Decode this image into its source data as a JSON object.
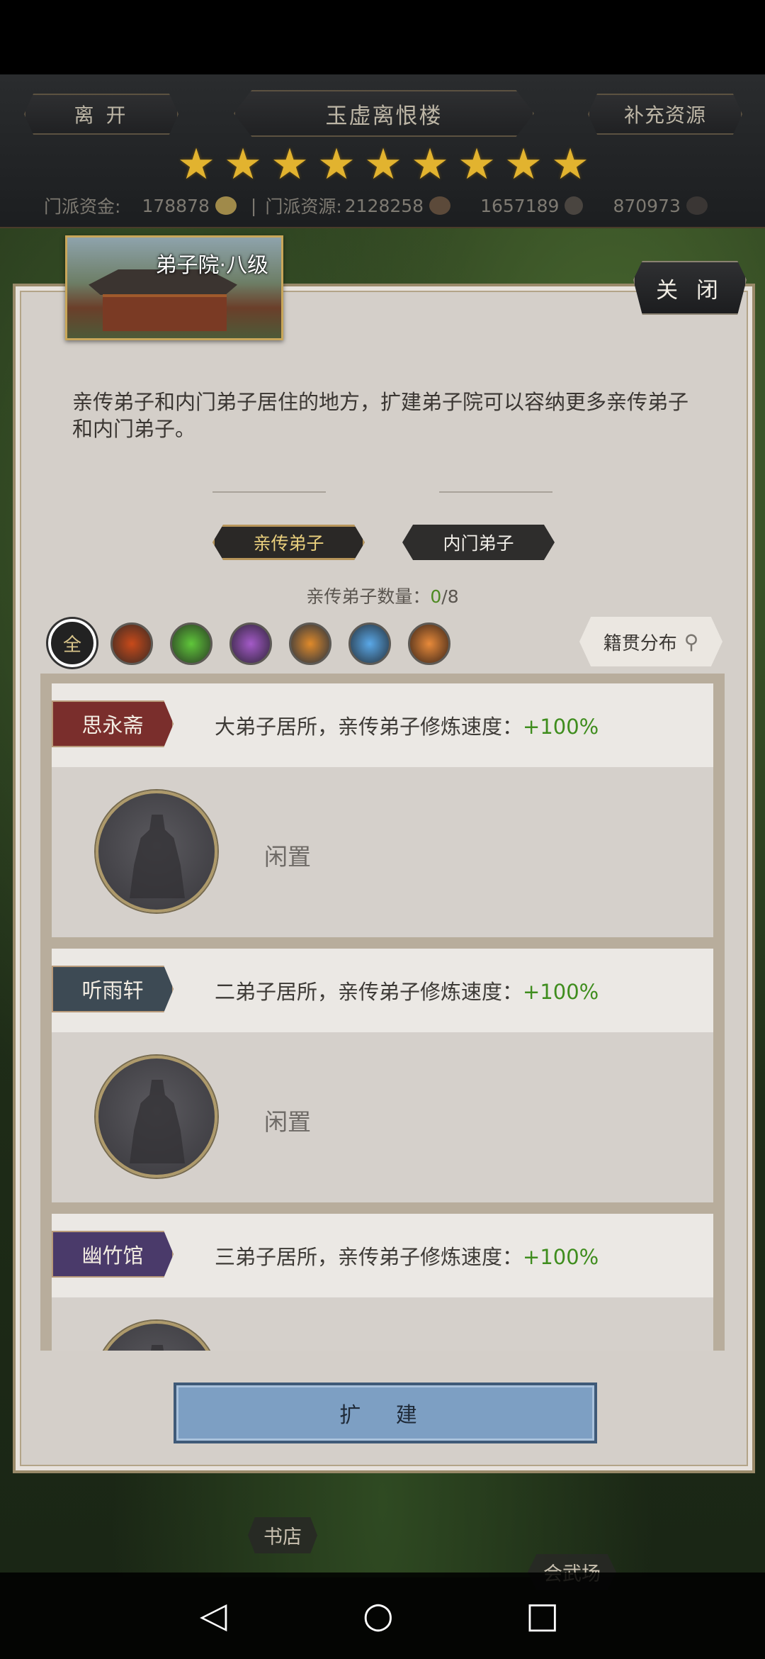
{
  "topbar": {
    "leave_label": "离 开",
    "title": "玉虚离恨楼",
    "supply_label": "补充资源",
    "stars": 9,
    "fund_label": "门派资金:",
    "fund_value": "178878",
    "separator": "|",
    "resource_label": "门派资源:",
    "resource_value": "2128258",
    "material2_value": "1657189",
    "material3_value": "870973"
  },
  "panel": {
    "building_title": "弟子院·八级",
    "close_label": "关 闭",
    "description": "亲传弟子和内门弟子居住的地方，扩建弟子院可以容纳更多亲传弟子和内门弟子。",
    "tabs": [
      {
        "label": "亲传弟子",
        "active": true
      },
      {
        "label": "内门弟子",
        "active": false
      }
    ],
    "count_label": "亲传弟子数量：",
    "count_current": "0",
    "count_max": "/8",
    "filter_all_label": "全",
    "filter_icons": [
      "sword-icon",
      "blade-icon",
      "spear-icon",
      "staff-icon",
      "hidden-weapon-icon",
      "fist-icon"
    ],
    "origin_label": "籍贯分布",
    "expand_label": "扩 建"
  },
  "residences": [
    {
      "name": "思永斋",
      "tag_color": "#7a2e2c",
      "desc": "大弟子居所，亲传弟子修炼速度：",
      "bonus": "+100%",
      "status": "闲置"
    },
    {
      "name": "听雨轩",
      "tag_color": "#3d4a54",
      "desc": "二弟子居所，亲传弟子修炼速度：",
      "bonus": "+100%",
      "status": "闲置"
    },
    {
      "name": "幽竹馆",
      "tag_color": "#4a3a6a",
      "desc": "三弟子居所，亲传弟子修炼速度：",
      "bonus": "+100%",
      "status": ""
    }
  ],
  "map_labels": {
    "bookstore": "书店",
    "arena": "会武场"
  },
  "colors": {
    "accent_gold": "#e2b32f",
    "bonus_green": "#3f8d1e"
  }
}
